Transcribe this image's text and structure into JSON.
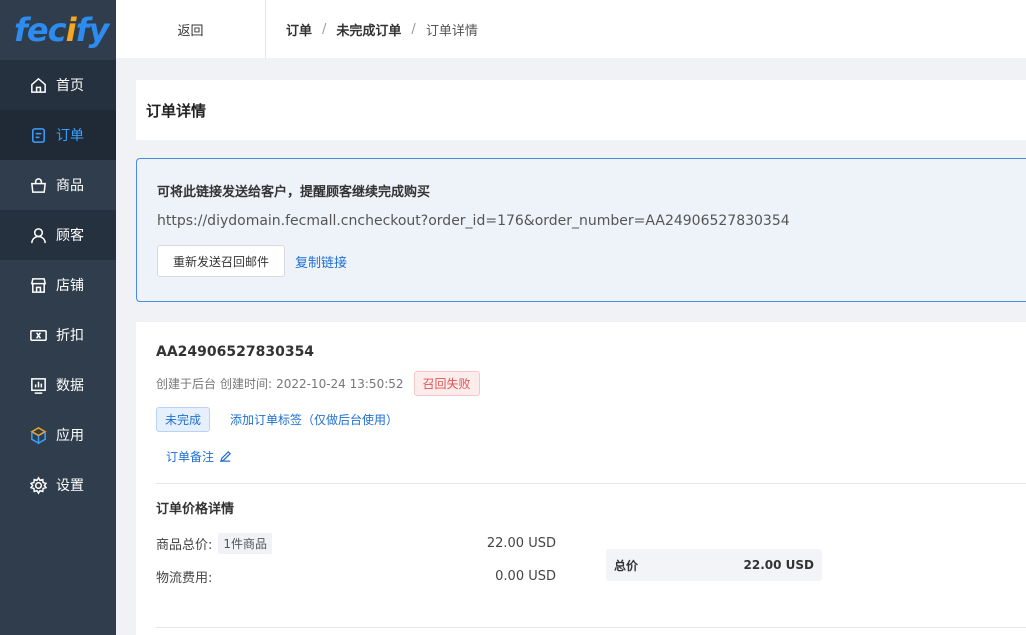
{
  "logo": {
    "text_pre": "fec",
    "text_o": "i",
    "text_post": "fy"
  },
  "sidebar": {
    "items": [
      {
        "label": "首页",
        "icon": "home-icon"
      },
      {
        "label": "订单",
        "icon": "order-icon"
      },
      {
        "label": "商品",
        "icon": "bag-icon"
      },
      {
        "label": "顾客",
        "icon": "user-icon"
      },
      {
        "label": "店铺",
        "icon": "store-icon"
      },
      {
        "label": "折扣",
        "icon": "ticket-icon"
      },
      {
        "label": "数据",
        "icon": "chart-icon"
      },
      {
        "label": "应用",
        "icon": "cube-icon"
      },
      {
        "label": "设置",
        "icon": "gear-icon"
      }
    ],
    "active_color": "#3aa0ff"
  },
  "header": {
    "back_label": "返回",
    "breadcrumb": [
      "订单",
      "未完成订单",
      "订单详情"
    ]
  },
  "page": {
    "title": "订单详情"
  },
  "recall": {
    "title": "可将此链接发送给客户，提醒顾客继续完成购买",
    "link": "https://diydomain.fecmall.cncheckout?order_id=176&order_number=AA24906527830354",
    "resend_label": "重新发送召回邮件",
    "copy_label": "复制链接"
  },
  "order": {
    "number": "AA24906527830354",
    "created_by": "创建于后台",
    "created_time_label": "创建时间:",
    "created_time": "2022-10-24 13:50:52",
    "recall_status": "召回失败",
    "status": "未完成",
    "add_tag_label": "添加订单标签（仅做后台使用）",
    "note_label": "订单备注"
  },
  "price": {
    "section_title": "订单价格详情",
    "goods_total_label": "商品总价:",
    "goods_qty": "1件商品",
    "goods_total": "22.00 USD",
    "shipping_label": "物流费用:",
    "shipping": "0.00 USD",
    "total_label": "总价",
    "total": "22.00 USD"
  }
}
